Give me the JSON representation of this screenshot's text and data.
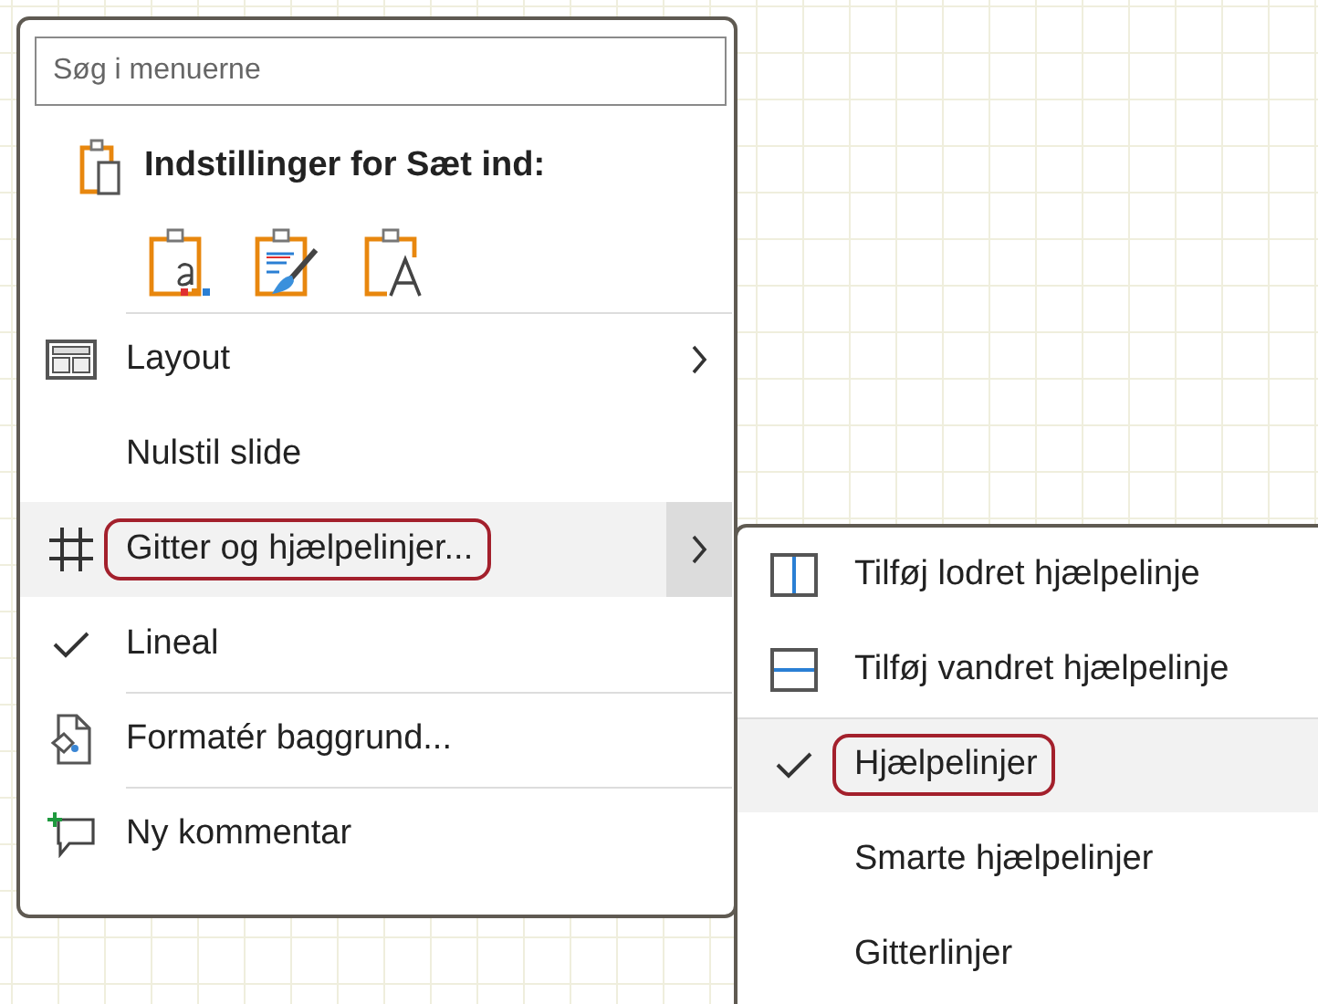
{
  "context_menu": {
    "search": {
      "placeholder": "Søg i menuerne"
    },
    "paste_header": {
      "title": "Indstillinger for Sæt ind:"
    },
    "items": [
      {
        "label": "Layout",
        "submenu": true,
        "checked": false,
        "selected": false,
        "highlighted": false,
        "separator_before": true
      },
      {
        "label": "Nulstil slide",
        "submenu": false,
        "checked": false,
        "selected": false,
        "highlighted": false,
        "separator_before": false
      },
      {
        "label": "Gitter og hjælpelinjer...",
        "submenu": true,
        "checked": false,
        "selected": true,
        "highlighted": true,
        "separator_before": false
      },
      {
        "label": "Lineal",
        "submenu": false,
        "checked": true,
        "selected": false,
        "highlighted": false,
        "separator_before": false
      },
      {
        "label": "Formatér baggrund...",
        "submenu": false,
        "checked": false,
        "selected": false,
        "highlighted": false,
        "separator_before": true
      },
      {
        "label": "Ny kommentar",
        "submenu": false,
        "checked": false,
        "selected": false,
        "highlighted": false,
        "separator_before": true
      }
    ]
  },
  "submenu": {
    "items": [
      {
        "label": "Tilføj lodret hjælpelinje",
        "checked": false,
        "selected": false,
        "highlighted": false,
        "separator_before": false
      },
      {
        "label": "Tilføj vandret hjælpelinje",
        "checked": false,
        "selected": false,
        "highlighted": false,
        "separator_before": false
      },
      {
        "label": "Hjælpelinjer",
        "checked": true,
        "selected": true,
        "highlighted": true,
        "separator_before": true
      },
      {
        "label": "Smarte hjælpelinjer",
        "checked": false,
        "selected": false,
        "highlighted": false,
        "separator_before": false
      },
      {
        "label": "Gitterlinjer",
        "checked": false,
        "selected": false,
        "highlighted": false,
        "separator_before": false
      }
    ]
  }
}
